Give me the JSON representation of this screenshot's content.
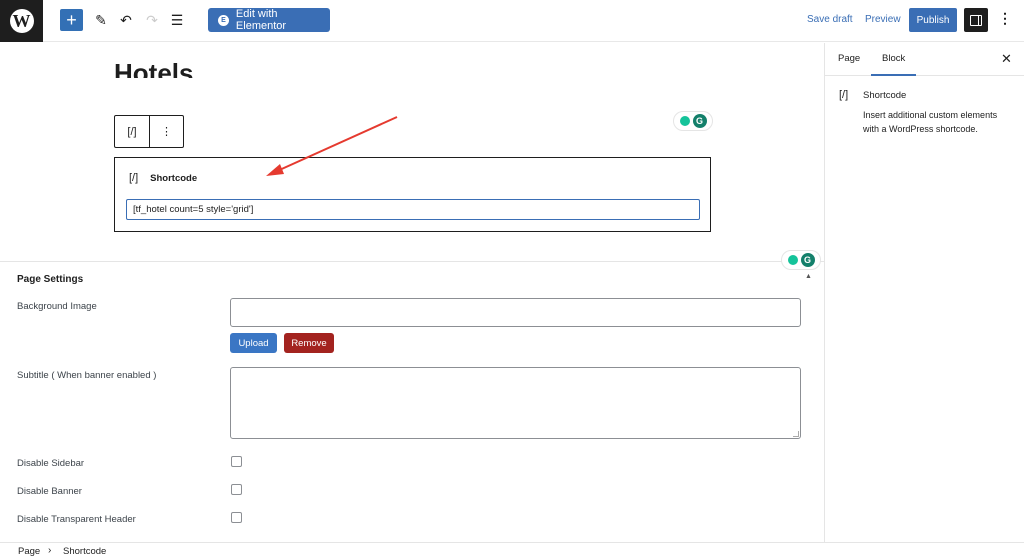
{
  "topbar": {
    "logo_icon": "wordpress-logo",
    "logo_glyph": "W",
    "add_glyph": "+",
    "tools_glyph": "✎",
    "undo_glyph": "↶",
    "redo_glyph": "↷",
    "list_view_glyph": "☰",
    "elementor_glyph": "E",
    "elementor_label": "Edit with Elementor",
    "save_draft_label": "Save draft",
    "preview_label": "Preview",
    "publish_label": "Publish",
    "options_glyph": "⋮"
  },
  "editor": {
    "page_title": "Hotels",
    "block_toolbar": {
      "shortcode_glyph": "[/]",
      "more_glyph": "⋮"
    },
    "shortcode_block": {
      "icon_glyph": "[/]",
      "label": "Shortcode",
      "value": "[tf_hotel count=5 style='grid']"
    },
    "grammarly": {
      "g_glyph": "G"
    }
  },
  "page_settings": {
    "title": "Page Settings",
    "collapse_glyph": "▲",
    "fields": {
      "background_image": {
        "label": "Background Image",
        "value": ""
      },
      "upload_label": "Upload",
      "remove_label": "Remove",
      "subtitle": {
        "label": "Subtitle ( When banner enabled )",
        "value": ""
      },
      "disable_sidebar": {
        "label": "Disable Sidebar",
        "checked": false
      },
      "disable_banner": {
        "label": "Disable Banner",
        "checked": false
      },
      "disable_transparent_header": {
        "label": "Disable Transparent Header",
        "checked": false
      }
    }
  },
  "sidebar": {
    "tabs": [
      {
        "label": "Page",
        "active": false
      },
      {
        "label": "Block",
        "active": true
      }
    ],
    "close_glyph": "✕",
    "block_card": {
      "icon_glyph": "[/]",
      "title": "Shortcode",
      "description": "Insert additional custom elements with a WordPress shortcode."
    }
  },
  "footer": {
    "breadcrumb": [
      "Page",
      "Shortcode"
    ],
    "separator": "›"
  },
  "colors": {
    "accent": "#3a6eb5",
    "remove": "#a3231f",
    "annotation_arrow": "#e53a2f",
    "grammarly": "#14806b"
  }
}
